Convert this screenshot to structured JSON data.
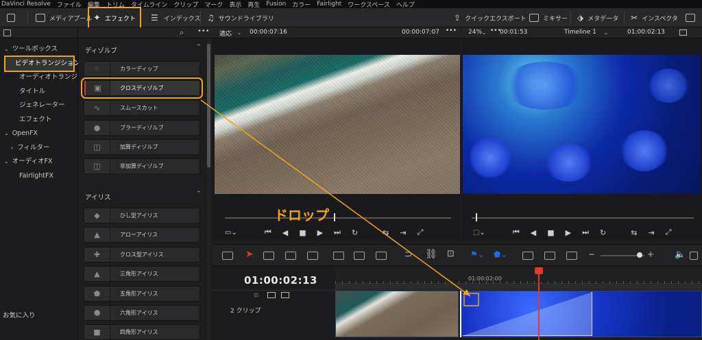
{
  "menubar": [
    "DaVinci Resolve",
    "ファイル",
    "編集",
    "トリム",
    "タイムライン",
    "クリップ",
    "マーク",
    "表示",
    "再生",
    "Fusion",
    "カラー",
    "Fairlight",
    "ワークスペース",
    "ヘルプ"
  ],
  "toolbar": {
    "media_pool": "メディアプール",
    "effects": "エフェクト",
    "index": "インデックス",
    "sound_library": "サウンドライブラリ",
    "quick_export": "クイックエクスポート",
    "mixer": "ミキサー",
    "metadata": "メタデータ",
    "inspector": "インスペクタ"
  },
  "toolbox": {
    "items": [
      "ツールボックス",
      "ビデオトランジション",
      "オーディオトランジション",
      "タイトル",
      "ジェネレーター",
      "エフェクト",
      "OpenFX",
      "フィルター",
      "オーディオFX",
      "FairlightFX"
    ],
    "favorites": "お気に入り"
  },
  "effects": {
    "dissolve_section": "ディゾルブ",
    "dissolve_items": [
      "カラーディップ",
      "クロスディゾルブ",
      "スムースカット",
      "ブラーディゾルブ",
      "加算ディゾルブ",
      "非加算ディゾルブ"
    ],
    "iris_section": "アイリス",
    "iris_items": [
      "ひし型アイリス",
      "アローアイリス",
      "クロス型アイリス",
      "三角形アイリス",
      "五角形アイリス",
      "六角形アイリス",
      "四角形アイリス"
    ]
  },
  "source_viewer": {
    "fit": "適応",
    "timecode_left": "00:00:07:16",
    "timecode_right": "00:00:07:07"
  },
  "timeline_viewer": {
    "zoom": "24%",
    "duration": "00:01:53",
    "name": "Timeline 1",
    "timecode": "01:00:02:13"
  },
  "timeline": {
    "timecode": "01:00:02:13",
    "ruler_label": "01:00:02:00",
    "track_label": "2 クリップ"
  },
  "annotation": {
    "drop_label": "ドロップ"
  },
  "colors": {
    "highlight": "#f0a41c",
    "playhead": "#e23a2a",
    "accent_blue": "#1e6dd8"
  }
}
